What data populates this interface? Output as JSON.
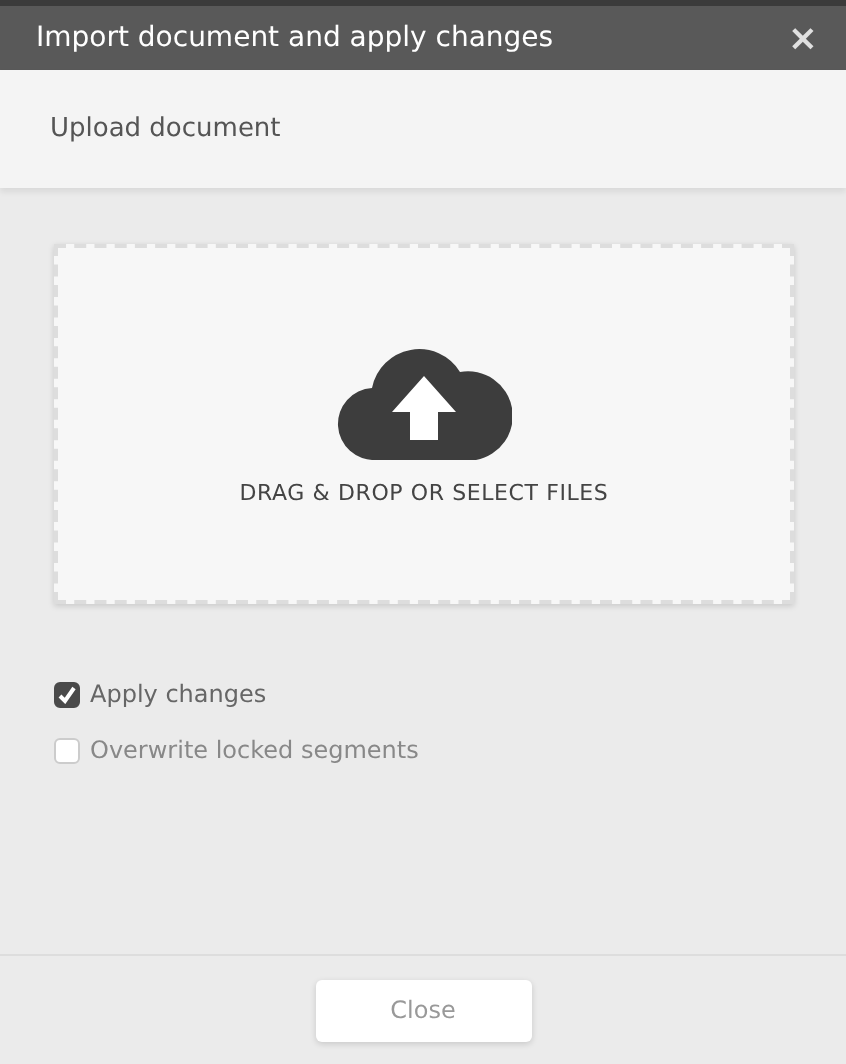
{
  "window": {
    "title": "Import document and apply changes",
    "close": "×"
  },
  "section": {
    "title": "Upload document"
  },
  "dropzone": {
    "label": "DRAG & DROP OR SELECT FILES"
  },
  "options": [
    {
      "label": "Apply changes",
      "checked": true
    },
    {
      "label": "Overwrite locked segments",
      "checked": false
    }
  ],
  "buttons": [
    "Close"
  ]
}
